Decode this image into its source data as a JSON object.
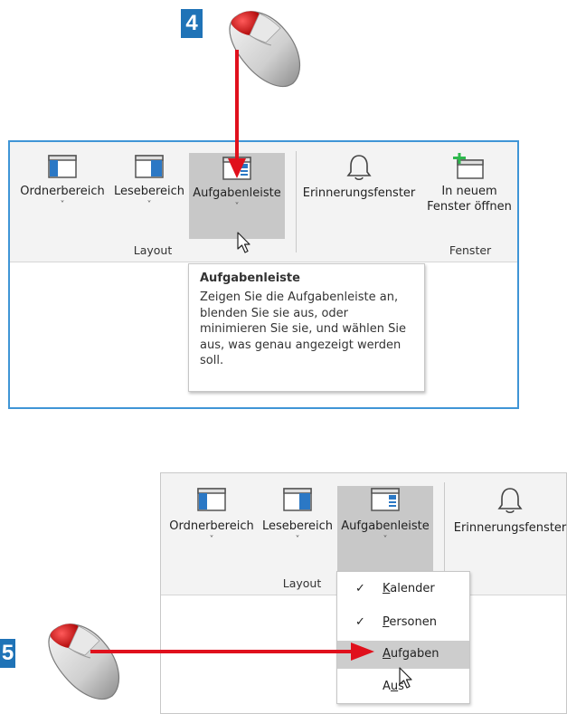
{
  "steps": {
    "top": "4",
    "bottom": "5"
  },
  "top_ribbon": {
    "buttons": [
      {
        "label": "Ordnerbereich",
        "chevron": "˅",
        "icon": "folder-pane-icon"
      },
      {
        "label": "Lesebereich",
        "chevron": "˅",
        "icon": "reading-pane-icon"
      },
      {
        "label": "Aufgabenleiste",
        "chevron": "˅",
        "icon": "todo-bar-icon"
      },
      {
        "label": "Erinnerungsfenster",
        "icon": "bell-icon"
      },
      {
        "label_line1": "In neuem",
        "label_line2": "Fenster öffnen",
        "icon": "new-window-icon"
      }
    ],
    "groups": {
      "layout": "Layout",
      "window": "Fenster"
    }
  },
  "tooltip": {
    "title": "Aufgabenleiste",
    "body": "Zeigen Sie die Aufgabenleiste an, blenden Sie sie aus, oder minimieren Sie sie, und wählen Sie aus, was genau angezeigt werden soll."
  },
  "bottom_ribbon": {
    "buttons": [
      {
        "label": "Ordnerbereich",
        "chevron": "˅"
      },
      {
        "label": "Lesebereich",
        "chevron": "˅"
      },
      {
        "label": "Aufgabenleiste",
        "chevron": "˅"
      },
      {
        "label": "Erinnerungsfenster"
      }
    ],
    "groups": {
      "layout": "Layout"
    }
  },
  "dropdown": {
    "items": [
      {
        "access_key": "K",
        "rest": "alender",
        "checked": true,
        "check_mark": "✓"
      },
      {
        "access_key": "P",
        "rest": "ersonen",
        "checked": true,
        "check_mark": "✓"
      },
      {
        "access_key": "A",
        "rest": "ufgaben",
        "checked": false,
        "hover": true
      },
      {
        "prefix": "A",
        "access_key": "u",
        "rest": "s",
        "checked": false
      }
    ]
  },
  "colors": {
    "arrow": "#e0101c",
    "badge": "#1f73b7",
    "panel_border": "#3f95d6",
    "pressed": "#c8c8c8"
  }
}
